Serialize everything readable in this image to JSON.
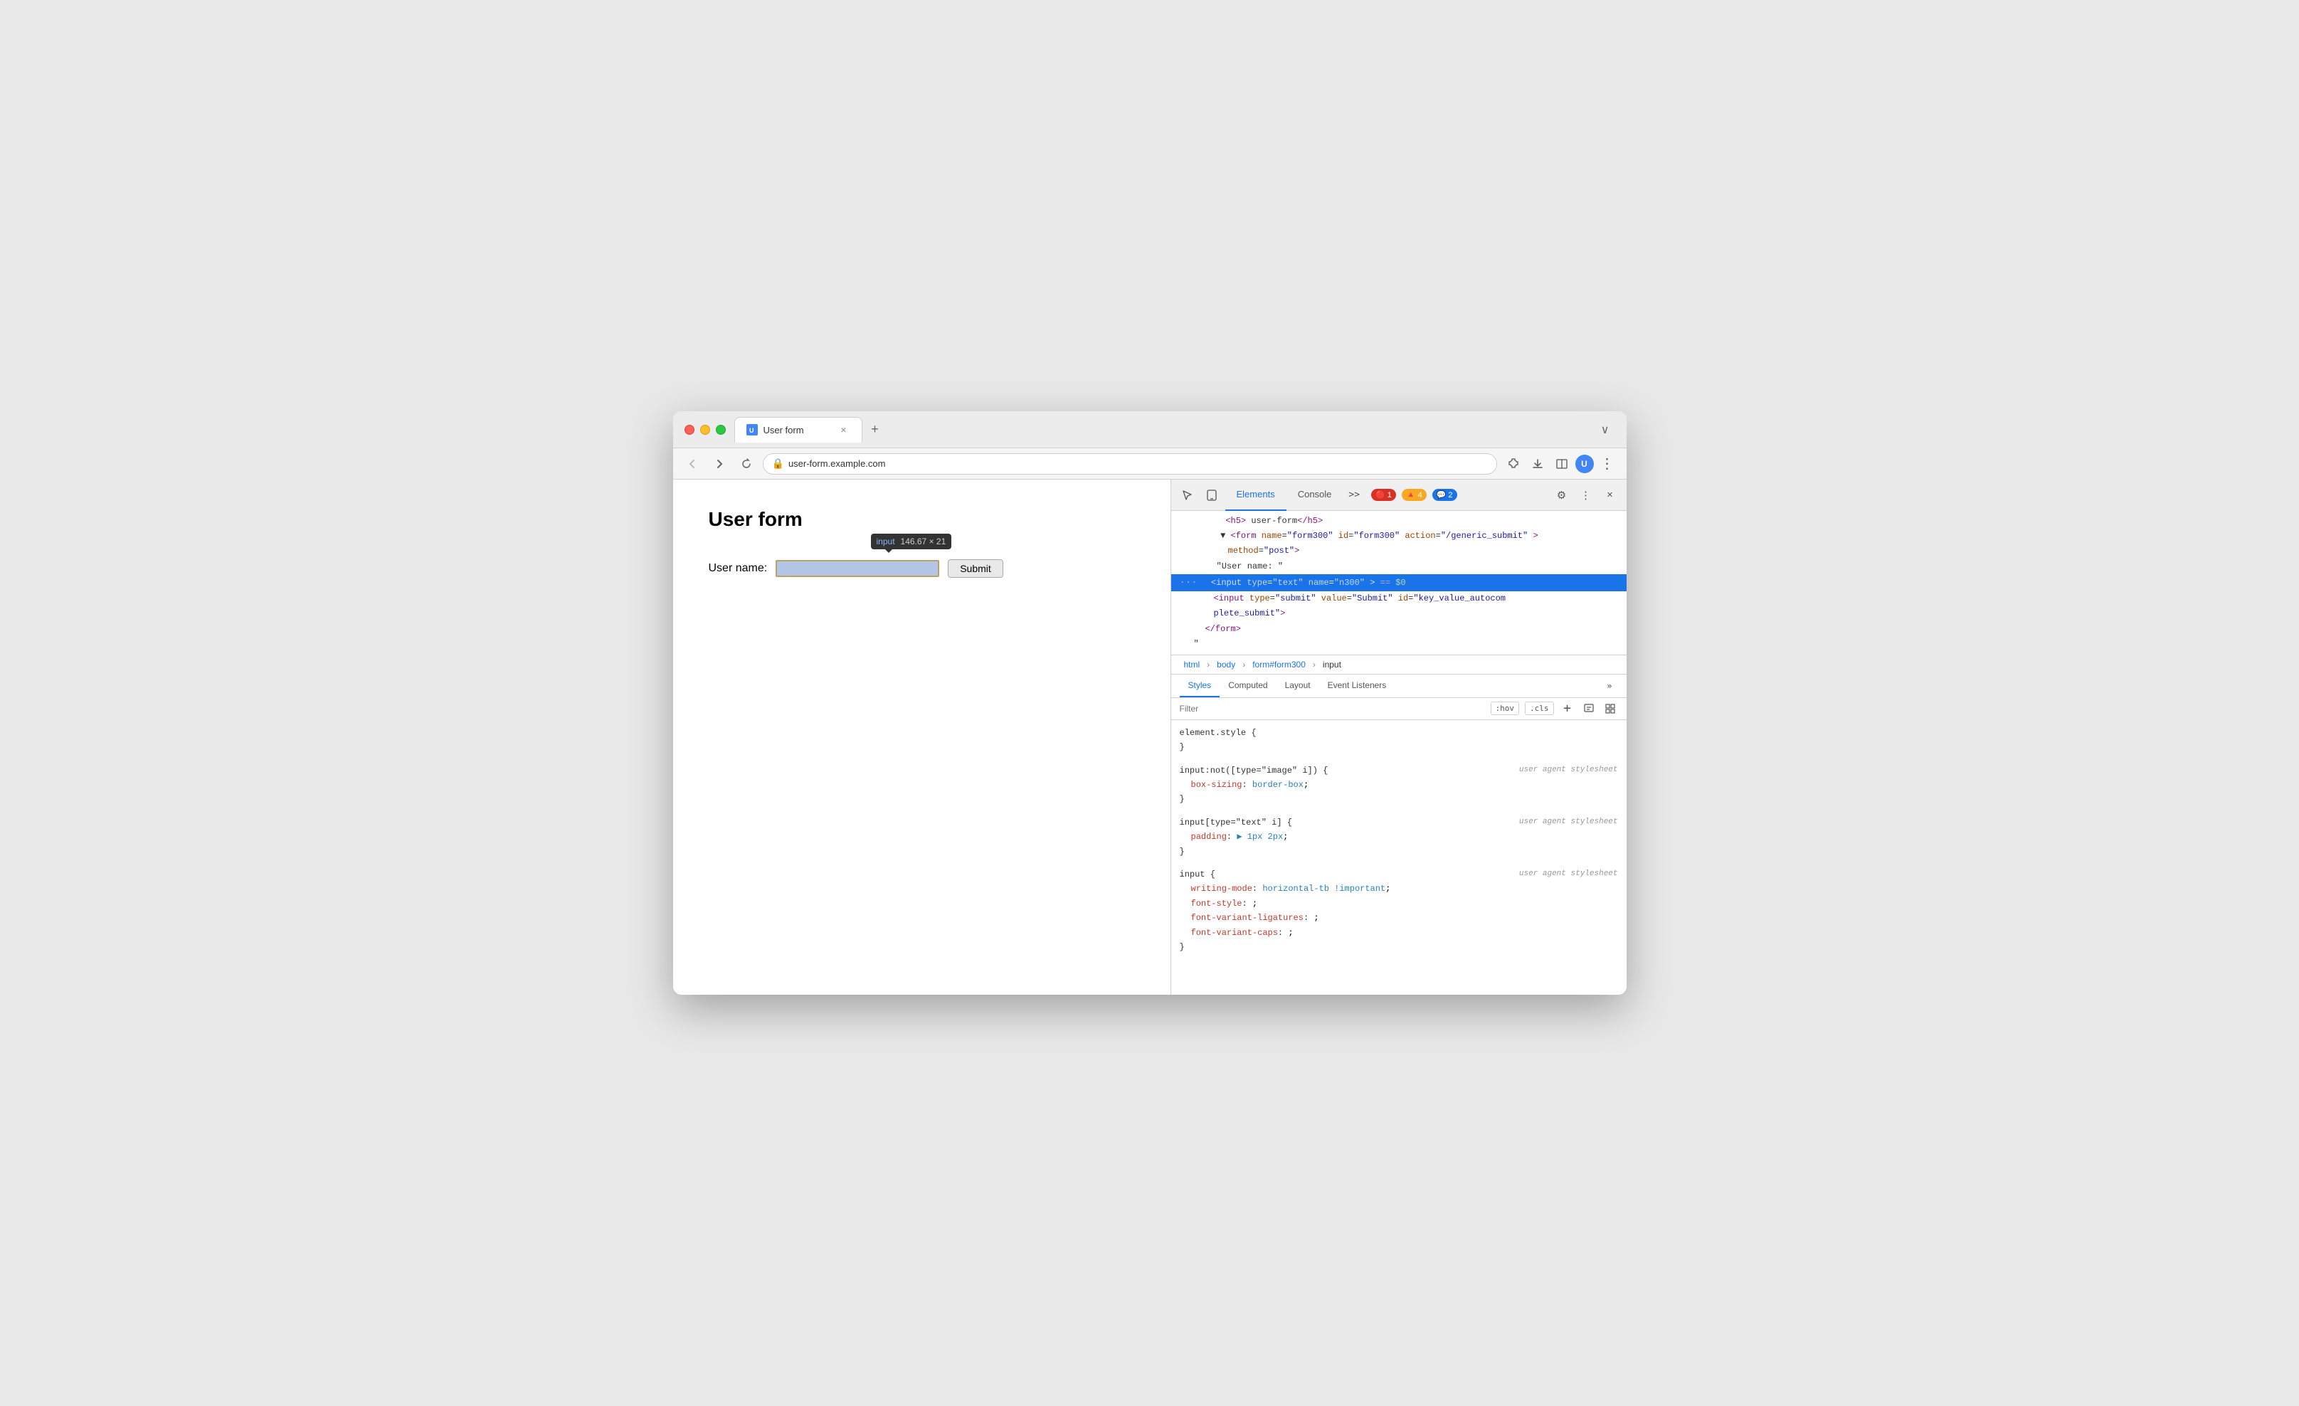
{
  "browser": {
    "tab": {
      "favicon": "U",
      "title": "User form",
      "close": "×"
    },
    "tab_new": "+",
    "tab_more": "∨",
    "nav": {
      "back": "←",
      "forward": "→",
      "reload": "↻",
      "url": "user-form.example.com",
      "url_icon": "🔒"
    },
    "nav_actions": {
      "extensions": "🧩",
      "download": "⬇",
      "split": "⊡",
      "more": "⋮"
    }
  },
  "page": {
    "title": "User form",
    "label": "User name:",
    "submit": "Submit",
    "tooltip": {
      "tag": "input",
      "size": "146.67 × 21"
    }
  },
  "devtools": {
    "header": {
      "inspect_icon": "⬚",
      "device_icon": "📱",
      "tabs": [
        "Elements",
        "Console"
      ],
      "tab_more": ">>",
      "badges": {
        "error": {
          "icon": "🔴",
          "count": "1"
        },
        "warning": {
          "icon": "🔺",
          "count": "4"
        },
        "message": {
          "icon": "💬",
          "count": "2"
        }
      },
      "settings_icon": "⚙",
      "more_icon": "⋮",
      "close_icon": "×"
    },
    "dom": {
      "line1": "▼<h5> user-form</h5>",
      "line2_tag": "form",
      "line2_attrs": "name=\"form300\" id=\"form300\" action=\"/generic_submit\"",
      "line2_extra": "method=\"post\"",
      "line3_text": "\"User name: \"",
      "line4_tag": "input",
      "line4_attrs": "type=\"text\" name=\"n300\"",
      "line4_equal": "==",
      "line4_ref": "$0",
      "line5_tag": "input",
      "line5_attrs": "type=\"submit\" value=\"Submit\" id=\"key_value_autocom",
      "line5_extra": "plete_submit\"",
      "line6_tag": "/form",
      "line7_text": "\""
    },
    "breadcrumb": [
      "html",
      "body",
      "form#form300",
      "input"
    ],
    "styles_tabs": [
      "Styles",
      "Computed",
      "Layout",
      "Event Listeners"
    ],
    "styles_more": "»",
    "filter": {
      "placeholder": "Filter",
      "hov_btn": ":hov",
      "cls_btn": ".cls",
      "add_btn": "+",
      "paint_icon": "🖌",
      "layout_icon": "⊡"
    },
    "css_rules": [
      {
        "selector": "element.style {",
        "close": "}",
        "source": "",
        "properties": []
      },
      {
        "selector": "input:not([type=\"image\" i]) {",
        "close": "}",
        "source": "user agent stylesheet",
        "properties": [
          {
            "name": "box-sizing",
            "value": "border-box",
            "colon": ":"
          }
        ]
      },
      {
        "selector": "input[type=\"text\" i] {",
        "close": "}",
        "source": "user agent stylesheet",
        "properties": [
          {
            "name": "padding",
            "value": "▶ 1px 2px",
            "colon": ":"
          }
        ]
      },
      {
        "selector": "input {",
        "close": "}",
        "source": "user agent stylesheet",
        "properties": [
          {
            "name": "writing-mode",
            "value": "horizontal-tb !important",
            "colon": ":"
          },
          {
            "name": "font-style",
            "value": ";",
            "colon": ":"
          },
          {
            "name": "font-variant-ligatures",
            "value": ";",
            "colon": ":"
          },
          {
            "name": "font-variant-caps",
            "value": ";",
            "colon": ":"
          }
        ]
      }
    ]
  }
}
